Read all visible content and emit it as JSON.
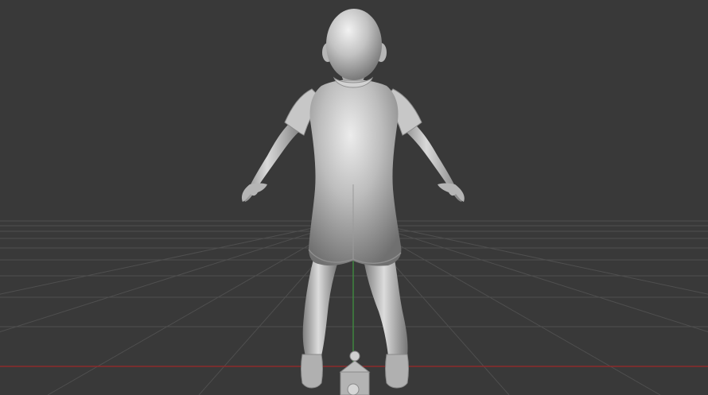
{
  "viewport": {
    "background_color": "#393939",
    "grid_color": "#4f4f4f",
    "x_axis_color": "#8c2b2b",
    "y_axis_color": "#3f8a3f",
    "mesh_color": "#b8b8b8",
    "mesh_highlight": "#e6e6e6",
    "mesh_shadow": "#6f6f6f",
    "shading": "solid-matcap",
    "object": "character-mesh-back-view",
    "gizmo": "camera-object-origin"
  }
}
